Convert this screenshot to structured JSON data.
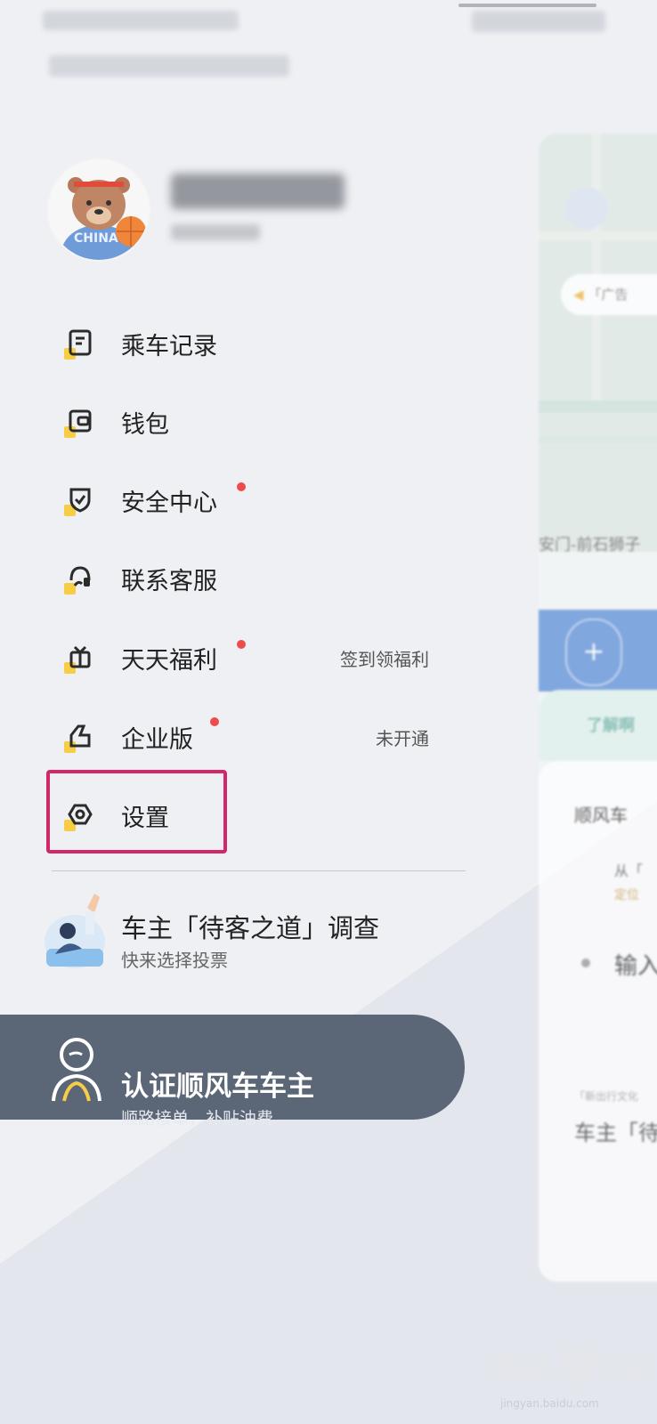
{
  "profile": {},
  "menu": {
    "items": [
      {
        "label": "乘车记录",
        "icon": "order-record-icon",
        "right": "",
        "dot": false
      },
      {
        "label": "钱包",
        "icon": "wallet-icon",
        "right": "",
        "dot": false
      },
      {
        "label": "安全中心",
        "icon": "shield-icon",
        "right": "",
        "dot": true
      },
      {
        "label": "联系客服",
        "icon": "headset-icon",
        "right": "",
        "dot": false
      },
      {
        "label": "天天福利",
        "icon": "gift-icon",
        "right": "签到领福利",
        "dot": true
      },
      {
        "label": "企业版",
        "icon": "enterprise-icon",
        "right": "未开通",
        "dot": true
      },
      {
        "label": "设置",
        "icon": "settings-icon",
        "right": "",
        "dot": false
      }
    ]
  },
  "survey": {
    "title": "车主「待客之道」调查",
    "subtitle": "快来选择投票"
  },
  "driver_banner": {
    "title": "认证顺风车车主",
    "subtitle": "顺路接单，补贴油费"
  },
  "background_panel": {
    "notice": "「广告",
    "place": "安门-前石狮子",
    "card_tag": "了解啊",
    "tab": "顺风车",
    "from": "从「",
    "locate": "定位",
    "input": "输入",
    "small": "「新出行文化",
    "bottom_text": "车主「待"
  },
  "watermark": {
    "text": "jingyan.baidu.com"
  },
  "colors": {
    "accent_yellow": "#f8cd46",
    "badge_red": "#ef4b4b",
    "highlight": "#d0286a",
    "banner": "#5b6676"
  }
}
